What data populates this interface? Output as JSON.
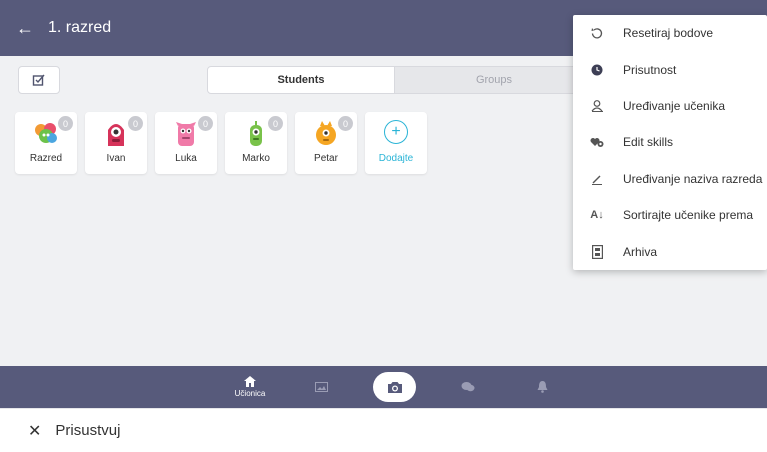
{
  "header": {
    "back_icon": "arrow-left-icon",
    "title": "1. razred"
  },
  "toolbar": {
    "select_icon": "checkbox-edit-icon",
    "tabs": [
      {
        "label": "Students",
        "active": true
      },
      {
        "label": "Groups",
        "active": false
      }
    ]
  },
  "students": [
    {
      "name": "Razred",
      "points": "0",
      "avatar": "class-group-avatar"
    },
    {
      "name": "Ivan",
      "points": "0",
      "avatar": "red-monster-avatar"
    },
    {
      "name": "Luka",
      "points": "0",
      "avatar": "pink-monster-avatar"
    },
    {
      "name": "Marko",
      "points": "0",
      "avatar": "green-monster-avatar"
    },
    {
      "name": "Petar",
      "points": "0",
      "avatar": "orange-monster-avatar"
    }
  ],
  "add_student": {
    "label": "Dodajte",
    "icon": "plus-circle-icon"
  },
  "menu": {
    "items": [
      {
        "label": "Resetiraj bodove",
        "icon": "reset-icon"
      },
      {
        "label": "Prisutnost",
        "icon": "clock-icon"
      },
      {
        "label": "Uređivanje učenika",
        "icon": "person-edit-icon"
      },
      {
        "label": "Edit skills",
        "icon": "hearts-icon"
      },
      {
        "label": "Uređivanje naziva razreda",
        "icon": "pencil-icon"
      },
      {
        "label": "Sortirajte učenike prema",
        "icon": "sort-az-icon"
      },
      {
        "label": "Arhiva",
        "icon": "archive-icon"
      }
    ]
  },
  "bottom_nav": {
    "items": [
      {
        "label": "Učionica",
        "icon": "home-icon",
        "active": true
      },
      {
        "label": "",
        "icon": "photo-icon"
      },
      {
        "label": "",
        "icon": "camera-icon"
      },
      {
        "label": "",
        "icon": "chat-icon"
      },
      {
        "label": "",
        "icon": "bell-icon"
      }
    ]
  },
  "footer": {
    "close_icon": "close-icon",
    "label": "Prisustvuj"
  },
  "colors": {
    "appbar": "#575a7b",
    "accent": "#2ab4d6",
    "background": "#f0f1f3"
  }
}
